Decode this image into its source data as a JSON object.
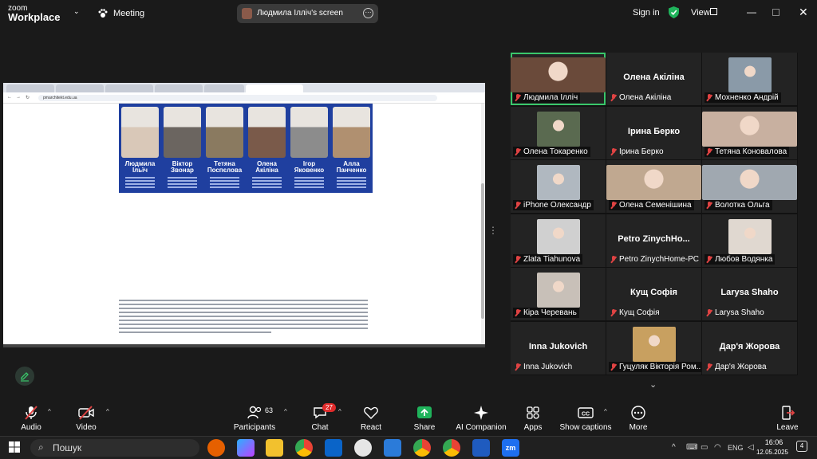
{
  "app": {
    "brand_top": "zoom",
    "brand_bottom": "Workplace",
    "meeting_label": "Meeting",
    "screen_share_label": "Людмила Ілліч's screen",
    "sign_in": "Sign in",
    "view": "View"
  },
  "browser": {
    "url": "pmarchitekt.edu.ua"
  },
  "speakers": [
    {
      "first": "Людмила",
      "last": "Ільїч"
    },
    {
      "first": "Віктор",
      "last": "Звонар"
    },
    {
      "first": "Тетяна",
      "last": "Поспєлова"
    },
    {
      "first": "Олена",
      "last": "Акіліна"
    },
    {
      "first": "Ігор",
      "last": "Яковенко"
    },
    {
      "first": "Алла",
      "last": "Панченко"
    }
  ],
  "participants": [
    {
      "label": "Людмила Ілліч",
      "big": "",
      "video": true
    },
    {
      "label": "Олена Акіліна",
      "big": "Олена Акіліна",
      "video": false
    },
    {
      "label": "Мохненко Андрій",
      "big": "",
      "video": true
    },
    {
      "label": "Олена Токаренко",
      "big": "",
      "video": true
    },
    {
      "label": "Ірина Берко",
      "big": "Ірина Берко",
      "video": false
    },
    {
      "label": "Тетяна Коновалова",
      "big": "",
      "video": true
    },
    {
      "label": "iPhone Олександр",
      "big": "",
      "video": true
    },
    {
      "label": "Олена Семенішина",
      "big": "",
      "video": true
    },
    {
      "label": "Волотка Ольга",
      "big": "",
      "video": true
    },
    {
      "label": "Zlata Tiahunova",
      "big": "",
      "video": true
    },
    {
      "label": "Petro ZinychHome-PC",
      "big": "Petro ZinychHo...",
      "video": false
    },
    {
      "label": "Любов Водянка",
      "big": "",
      "video": true
    },
    {
      "label": "Кіра Черевань",
      "big": "",
      "video": true
    },
    {
      "label": "Кущ Софія",
      "big": "Кущ Софія",
      "video": false
    },
    {
      "label": "Larysa Shaho",
      "big": "Larysa Shaho",
      "video": false
    },
    {
      "label": "Inna Jukovich",
      "big": "Inna Jukovich",
      "video": false
    },
    {
      "label": "Гуцуляк Вікторія Ром...",
      "big": "",
      "video": true
    },
    {
      "label": "Дар'я Жорова",
      "big": "Дар'я Жорова",
      "video": false
    }
  ],
  "toolbar": {
    "audio": "Audio",
    "video": "Video",
    "participants": "Participants",
    "participants_count": "63",
    "chat": "Chat",
    "chat_badge": "27",
    "react": "React",
    "share": "Share",
    "ai_companion": "AI Companion",
    "apps": "Apps",
    "show_captions": "Show captions",
    "more": "More",
    "leave": "Leave"
  },
  "taskbar": {
    "search": "Пошук",
    "lang": "ENG",
    "time": "16:06",
    "date": "12.05.2025",
    "notifications": "4"
  },
  "colors": {
    "accent_green": "#3ac86b",
    "share_green": "#1fb35b",
    "muted_red": "#e04343",
    "banner_blue": "#1f3f9f"
  }
}
